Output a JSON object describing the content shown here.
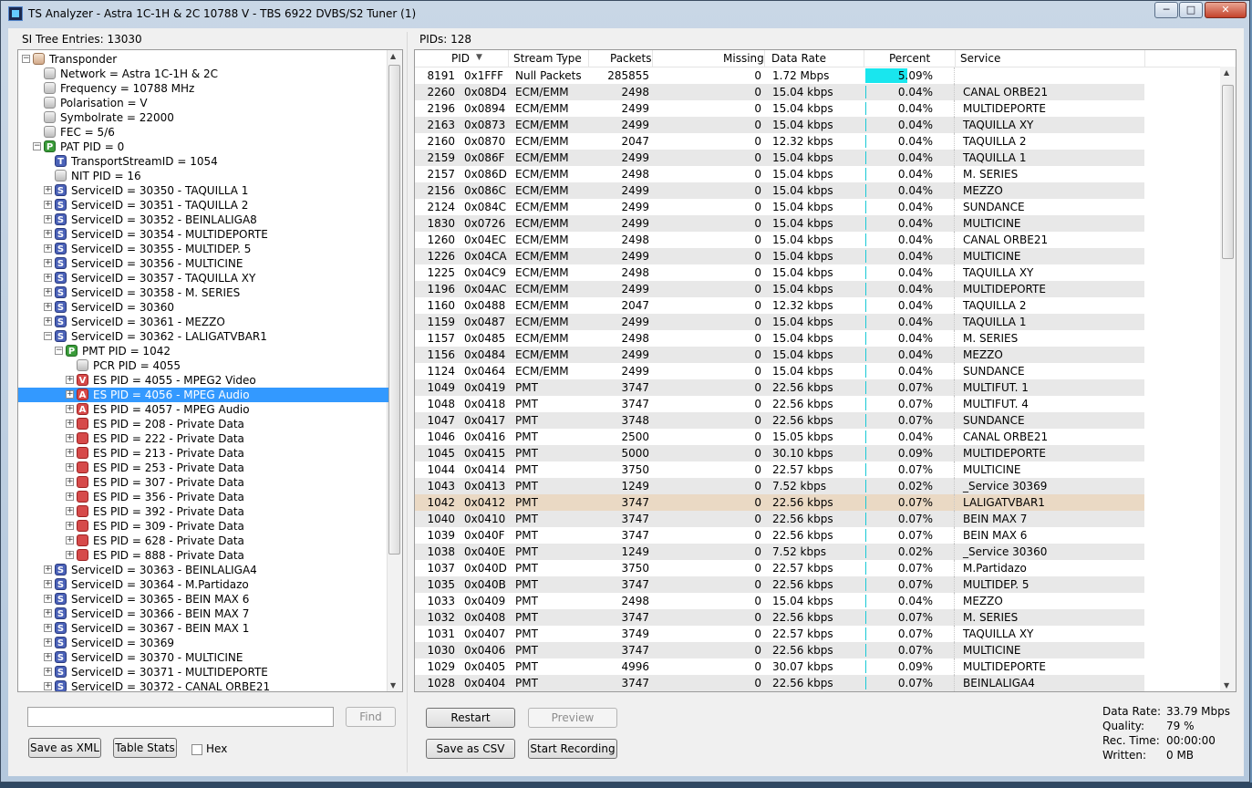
{
  "window": {
    "title": "TS Analyzer - Astra 1C-1H & 2C 10788 V - TBS 6922 DVBS/S2 Tuner (1)",
    "controls": {
      "minimize": "─",
      "maximize": "□",
      "close": "✕"
    }
  },
  "left": {
    "header": "SI Tree Entries: 13030",
    "tree": [
      {
        "label": "Transponder",
        "level": 0,
        "icon": "tan",
        "expander": "−"
      },
      {
        "label": "Network = Astra 1C-1H & 2C",
        "level": 1,
        "icon": "gray",
        "expander": ""
      },
      {
        "label": "Frequency = 10788 MHz",
        "level": 1,
        "icon": "gray",
        "expander": ""
      },
      {
        "label": "Polarisation = V",
        "level": 1,
        "icon": "gray",
        "expander": ""
      },
      {
        "label": "Symbolrate = 22000",
        "level": 1,
        "icon": "gray",
        "expander": ""
      },
      {
        "label": "FEC = 5/6",
        "level": 1,
        "icon": "gray",
        "expander": ""
      },
      {
        "label": "PAT PID = 0",
        "level": 1,
        "icon": "green",
        "letter": "P",
        "expander": "−"
      },
      {
        "label": "TransportStreamID = 1054",
        "level": 2,
        "icon": "blue",
        "letter": "T",
        "expander": ""
      },
      {
        "label": "NIT PID = 16",
        "level": 2,
        "icon": "gray",
        "expander": ""
      },
      {
        "label": "ServiceID = 30350 - TAQUILLA 1",
        "level": 2,
        "icon": "blue",
        "letter": "S",
        "expander": "+"
      },
      {
        "label": "ServiceID = 30351 - TAQUILLA 2",
        "level": 2,
        "icon": "blue",
        "letter": "S",
        "expander": "+"
      },
      {
        "label": "ServiceID = 30352 - BEINLALIGA8",
        "level": 2,
        "icon": "blue",
        "letter": "S",
        "expander": "+"
      },
      {
        "label": "ServiceID = 30354 - MULTIDEPORTE",
        "level": 2,
        "icon": "blue",
        "letter": "S",
        "expander": "+"
      },
      {
        "label": "ServiceID = 30355 - MULTIDEP. 5",
        "level": 2,
        "icon": "blue",
        "letter": "S",
        "expander": "+"
      },
      {
        "label": "ServiceID = 30356 - MULTICINE",
        "level": 2,
        "icon": "blue",
        "letter": "S",
        "expander": "+"
      },
      {
        "label": "ServiceID = 30357 - TAQUILLA XY",
        "level": 2,
        "icon": "blue",
        "letter": "S",
        "expander": "+"
      },
      {
        "label": "ServiceID = 30358 - M. SERIES",
        "level": 2,
        "icon": "blue",
        "letter": "S",
        "expander": "+"
      },
      {
        "label": "ServiceID = 30360",
        "level": 2,
        "icon": "blue",
        "letter": "S",
        "expander": "+"
      },
      {
        "label": "ServiceID = 30361 - MEZZO",
        "level": 2,
        "icon": "blue",
        "letter": "S",
        "expander": "+"
      },
      {
        "label": "ServiceID = 30362 - LALIGATVBAR1",
        "level": 2,
        "icon": "blue",
        "letter": "S",
        "expander": "−"
      },
      {
        "label": "PMT PID = 1042",
        "level": 3,
        "icon": "green",
        "letter": "P",
        "expander": "−"
      },
      {
        "label": "PCR PID = 4055",
        "level": 4,
        "icon": "gray",
        "expander": ""
      },
      {
        "label": "ES PID = 4055 - MPEG2 Video",
        "level": 4,
        "icon": "red",
        "letter": "V",
        "expander": "+"
      },
      {
        "label": "ES PID = 4056 - MPEG Audio",
        "level": 4,
        "icon": "red",
        "letter": "A",
        "expander": "+",
        "selected": true
      },
      {
        "label": "ES PID = 4057 - MPEG Audio",
        "level": 4,
        "icon": "red",
        "letter": "A",
        "expander": "+"
      },
      {
        "label": "ES PID = 208 - Private Data",
        "level": 4,
        "icon": "red",
        "expander": "+"
      },
      {
        "label": "ES PID = 222 - Private Data",
        "level": 4,
        "icon": "red",
        "expander": "+"
      },
      {
        "label": "ES PID = 213 - Private Data",
        "level": 4,
        "icon": "red",
        "expander": "+"
      },
      {
        "label": "ES PID = 253 - Private Data",
        "level": 4,
        "icon": "red",
        "expander": "+"
      },
      {
        "label": "ES PID = 307 - Private Data",
        "level": 4,
        "icon": "red",
        "expander": "+"
      },
      {
        "label": "ES PID = 356 - Private Data",
        "level": 4,
        "icon": "red",
        "expander": "+"
      },
      {
        "label": "ES PID = 392 - Private Data",
        "level": 4,
        "icon": "red",
        "expander": "+"
      },
      {
        "label": "ES PID = 309 - Private Data",
        "level": 4,
        "icon": "red",
        "expander": "+"
      },
      {
        "label": "ES PID = 628 - Private Data",
        "level": 4,
        "icon": "red",
        "expander": "+"
      },
      {
        "label": "ES PID = 888 - Private Data",
        "level": 4,
        "icon": "red",
        "expander": "+"
      },
      {
        "label": "ServiceID = 30363 - BEINLALIGA4",
        "level": 2,
        "icon": "blue",
        "letter": "S",
        "expander": "+"
      },
      {
        "label": "ServiceID = 30364 - M.Partidazo",
        "level": 2,
        "icon": "blue",
        "letter": "S",
        "expander": "+"
      },
      {
        "label": "ServiceID = 30365 - BEIN MAX 6",
        "level": 2,
        "icon": "blue",
        "letter": "S",
        "expander": "+"
      },
      {
        "label": "ServiceID = 30366 - BEIN MAX 7",
        "level": 2,
        "icon": "blue",
        "letter": "S",
        "expander": "+"
      },
      {
        "label": "ServiceID = 30367 - BEIN MAX 1",
        "level": 2,
        "icon": "blue",
        "letter": "S",
        "expander": "+"
      },
      {
        "label": "ServiceID = 30369",
        "level": 2,
        "icon": "blue",
        "letter": "S",
        "expander": "+"
      },
      {
        "label": "ServiceID = 30370 - MULTICINE",
        "level": 2,
        "icon": "blue",
        "letter": "S",
        "expander": "+"
      },
      {
        "label": "ServiceID = 30371 - MULTIDEPORTE",
        "level": 2,
        "icon": "blue",
        "letter": "S",
        "expander": "+"
      },
      {
        "label": "ServiceID = 30372 - CANAL ORBE21",
        "level": 2,
        "icon": "blue",
        "letter": "S",
        "expander": "+"
      }
    ],
    "search": {
      "value": "",
      "placeholder": ""
    },
    "find_label": "Find",
    "save_xml_label": "Save as XML",
    "table_stats_label": "Table Stats",
    "hex_label": "Hex"
  },
  "right": {
    "header": "PIDs: 128",
    "columns": {
      "pid": "PID",
      "type": "Stream Type",
      "packets": "Packets",
      "missing": "Missing",
      "rate": "Data Rate",
      "percent": "Percent",
      "service": "Service"
    },
    "rows": [
      {
        "pid": "8191",
        "hex": "0x1FFF",
        "type": "Null Packets",
        "packets": "285855",
        "missing": "0",
        "rate": "1.72 Mbps",
        "percent": "5.09%",
        "pct": 5.09,
        "service": ""
      },
      {
        "pid": "2260",
        "hex": "0x08D4",
        "type": "ECM/EMM",
        "packets": "2498",
        "missing": "0",
        "rate": "15.04 kbps",
        "percent": "0.04%",
        "pct": 0.04,
        "service": "CANAL ORBE21"
      },
      {
        "pid": "2196",
        "hex": "0x0894",
        "type": "ECM/EMM",
        "packets": "2499",
        "missing": "0",
        "rate": "15.04 kbps",
        "percent": "0.04%",
        "pct": 0.04,
        "service": "MULTIDEPORTE"
      },
      {
        "pid": "2163",
        "hex": "0x0873",
        "type": "ECM/EMM",
        "packets": "2499",
        "missing": "0",
        "rate": "15.04 kbps",
        "percent": "0.04%",
        "pct": 0.04,
        "service": "TAQUILLA XY"
      },
      {
        "pid": "2160",
        "hex": "0x0870",
        "type": "ECM/EMM",
        "packets": "2047",
        "missing": "0",
        "rate": "12.32 kbps",
        "percent": "0.04%",
        "pct": 0.04,
        "service": "TAQUILLA 2"
      },
      {
        "pid": "2159",
        "hex": "0x086F",
        "type": "ECM/EMM",
        "packets": "2499",
        "missing": "0",
        "rate": "15.04 kbps",
        "percent": "0.04%",
        "pct": 0.04,
        "service": "TAQUILLA 1"
      },
      {
        "pid": "2157",
        "hex": "0x086D",
        "type": "ECM/EMM",
        "packets": "2498",
        "missing": "0",
        "rate": "15.04 kbps",
        "percent": "0.04%",
        "pct": 0.04,
        "service": "M. SERIES"
      },
      {
        "pid": "2156",
        "hex": "0x086C",
        "type": "ECM/EMM",
        "packets": "2499",
        "missing": "0",
        "rate": "15.04 kbps",
        "percent": "0.04%",
        "pct": 0.04,
        "service": "MEZZO"
      },
      {
        "pid": "2124",
        "hex": "0x084C",
        "type": "ECM/EMM",
        "packets": "2499",
        "missing": "0",
        "rate": "15.04 kbps",
        "percent": "0.04%",
        "pct": 0.04,
        "service": "SUNDANCE"
      },
      {
        "pid": "1830",
        "hex": "0x0726",
        "type": "ECM/EMM",
        "packets": "2499",
        "missing": "0",
        "rate": "15.04 kbps",
        "percent": "0.04%",
        "pct": 0.04,
        "service": "MULTICINE"
      },
      {
        "pid": "1260",
        "hex": "0x04EC",
        "type": "ECM/EMM",
        "packets": "2498",
        "missing": "0",
        "rate": "15.04 kbps",
        "percent": "0.04%",
        "pct": 0.04,
        "service": "CANAL ORBE21"
      },
      {
        "pid": "1226",
        "hex": "0x04CA",
        "type": "ECM/EMM",
        "packets": "2499",
        "missing": "0",
        "rate": "15.04 kbps",
        "percent": "0.04%",
        "pct": 0.04,
        "service": "MULTICINE"
      },
      {
        "pid": "1225",
        "hex": "0x04C9",
        "type": "ECM/EMM",
        "packets": "2498",
        "missing": "0",
        "rate": "15.04 kbps",
        "percent": "0.04%",
        "pct": 0.04,
        "service": "TAQUILLA XY"
      },
      {
        "pid": "1196",
        "hex": "0x04AC",
        "type": "ECM/EMM",
        "packets": "2499",
        "missing": "0",
        "rate": "15.04 kbps",
        "percent": "0.04%",
        "pct": 0.04,
        "service": "MULTIDEPORTE"
      },
      {
        "pid": "1160",
        "hex": "0x0488",
        "type": "ECM/EMM",
        "packets": "2047",
        "missing": "0",
        "rate": "12.32 kbps",
        "percent": "0.04%",
        "pct": 0.04,
        "service": "TAQUILLA 2"
      },
      {
        "pid": "1159",
        "hex": "0x0487",
        "type": "ECM/EMM",
        "packets": "2499",
        "missing": "0",
        "rate": "15.04 kbps",
        "percent": "0.04%",
        "pct": 0.04,
        "service": "TAQUILLA 1"
      },
      {
        "pid": "1157",
        "hex": "0x0485",
        "type": "ECM/EMM",
        "packets": "2498",
        "missing": "0",
        "rate": "15.04 kbps",
        "percent": "0.04%",
        "pct": 0.04,
        "service": "M. SERIES"
      },
      {
        "pid": "1156",
        "hex": "0x0484",
        "type": "ECM/EMM",
        "packets": "2499",
        "missing": "0",
        "rate": "15.04 kbps",
        "percent": "0.04%",
        "pct": 0.04,
        "service": "MEZZO"
      },
      {
        "pid": "1124",
        "hex": "0x0464",
        "type": "ECM/EMM",
        "packets": "2499",
        "missing": "0",
        "rate": "15.04 kbps",
        "percent": "0.04%",
        "pct": 0.04,
        "service": "SUNDANCE"
      },
      {
        "pid": "1049",
        "hex": "0x0419",
        "type": "PMT",
        "packets": "3747",
        "missing": "0",
        "rate": "22.56 kbps",
        "percent": "0.07%",
        "pct": 0.07,
        "service": "MULTIFUT. 1"
      },
      {
        "pid": "1048",
        "hex": "0x0418",
        "type": "PMT",
        "packets": "3747",
        "missing": "0",
        "rate": "22.56 kbps",
        "percent": "0.07%",
        "pct": 0.07,
        "service": "MULTIFUT. 4"
      },
      {
        "pid": "1047",
        "hex": "0x0417",
        "type": "PMT",
        "packets": "3748",
        "missing": "0",
        "rate": "22.56 kbps",
        "percent": "0.07%",
        "pct": 0.07,
        "service": "SUNDANCE"
      },
      {
        "pid": "1046",
        "hex": "0x0416",
        "type": "PMT",
        "packets": "2500",
        "missing": "0",
        "rate": "15.05 kbps",
        "percent": "0.04%",
        "pct": 0.04,
        "service": "CANAL ORBE21"
      },
      {
        "pid": "1045",
        "hex": "0x0415",
        "type": "PMT",
        "packets": "5000",
        "missing": "0",
        "rate": "30.10 kbps",
        "percent": "0.09%",
        "pct": 0.09,
        "service": "MULTIDEPORTE"
      },
      {
        "pid": "1044",
        "hex": "0x0414",
        "type": "PMT",
        "packets": "3750",
        "missing": "0",
        "rate": "22.57 kbps",
        "percent": "0.07%",
        "pct": 0.07,
        "service": "MULTICINE"
      },
      {
        "pid": "1043",
        "hex": "0x0413",
        "type": "PMT",
        "packets": "1249",
        "missing": "0",
        "rate": "7.52 kbps",
        "percent": "0.02%",
        "pct": 0.02,
        "service": "_Service 30369"
      },
      {
        "pid": "1042",
        "hex": "0x0412",
        "type": "PMT",
        "packets": "3747",
        "missing": "0",
        "rate": "22.56 kbps",
        "percent": "0.07%",
        "pct": 0.07,
        "service": "LALIGATVBAR1",
        "selected": true
      },
      {
        "pid": "1040",
        "hex": "0x0410",
        "type": "PMT",
        "packets": "3747",
        "missing": "0",
        "rate": "22.56 kbps",
        "percent": "0.07%",
        "pct": 0.07,
        "service": "BEIN MAX 7"
      },
      {
        "pid": "1039",
        "hex": "0x040F",
        "type": "PMT",
        "packets": "3747",
        "missing": "0",
        "rate": "22.56 kbps",
        "percent": "0.07%",
        "pct": 0.07,
        "service": "BEIN MAX 6"
      },
      {
        "pid": "1038",
        "hex": "0x040E",
        "type": "PMT",
        "packets": "1249",
        "missing": "0",
        "rate": "7.52 kbps",
        "percent": "0.02%",
        "pct": 0.02,
        "service": "_Service 30360"
      },
      {
        "pid": "1037",
        "hex": "0x040D",
        "type": "PMT",
        "packets": "3750",
        "missing": "0",
        "rate": "22.57 kbps",
        "percent": "0.07%",
        "pct": 0.07,
        "service": "M.Partidazo"
      },
      {
        "pid": "1035",
        "hex": "0x040B",
        "type": "PMT",
        "packets": "3747",
        "missing": "0",
        "rate": "22.56 kbps",
        "percent": "0.07%",
        "pct": 0.07,
        "service": "MULTIDEP. 5"
      },
      {
        "pid": "1033",
        "hex": "0x0409",
        "type": "PMT",
        "packets": "2498",
        "missing": "0",
        "rate": "15.04 kbps",
        "percent": "0.04%",
        "pct": 0.04,
        "service": "MEZZO"
      },
      {
        "pid": "1032",
        "hex": "0x0408",
        "type": "PMT",
        "packets": "3747",
        "missing": "0",
        "rate": "22.56 kbps",
        "percent": "0.07%",
        "pct": 0.07,
        "service": "M. SERIES"
      },
      {
        "pid": "1031",
        "hex": "0x0407",
        "type": "PMT",
        "packets": "3749",
        "missing": "0",
        "rate": "22.57 kbps",
        "percent": "0.07%",
        "pct": 0.07,
        "service": "TAQUILLA XY"
      },
      {
        "pid": "1030",
        "hex": "0x0406",
        "type": "PMT",
        "packets": "3747",
        "missing": "0",
        "rate": "22.56 kbps",
        "percent": "0.07%",
        "pct": 0.07,
        "service": "MULTICINE"
      },
      {
        "pid": "1029",
        "hex": "0x0405",
        "type": "PMT",
        "packets": "4996",
        "missing": "0",
        "rate": "30.07 kbps",
        "percent": "0.09%",
        "pct": 0.09,
        "service": "MULTIDEPORTE"
      },
      {
        "pid": "1028",
        "hex": "0x0404",
        "type": "PMT",
        "packets": "3747",
        "missing": "0",
        "rate": "22.56 kbps",
        "percent": "0.07%",
        "pct": 0.07,
        "service": "BEINLALIGA4"
      }
    ],
    "restart_label": "Restart",
    "preview_label": "Preview",
    "save_csv_label": "Save as CSV",
    "start_recording_label": "Start Recording"
  },
  "stats": {
    "data_rate_label": "Data Rate:",
    "data_rate": "33.79 Mbps",
    "quality_label": "Quality:",
    "quality": "79 %",
    "rec_time_label": "Rec. Time:",
    "rec_time": "00:00:00",
    "written_label": "Written:",
    "written": "0 MB"
  },
  "colors": {
    "selection": "#3399ff",
    "percent_bar": "#19e6ee",
    "selected_row": "#ead9c4",
    "alt_row": "#e8e8e8"
  }
}
